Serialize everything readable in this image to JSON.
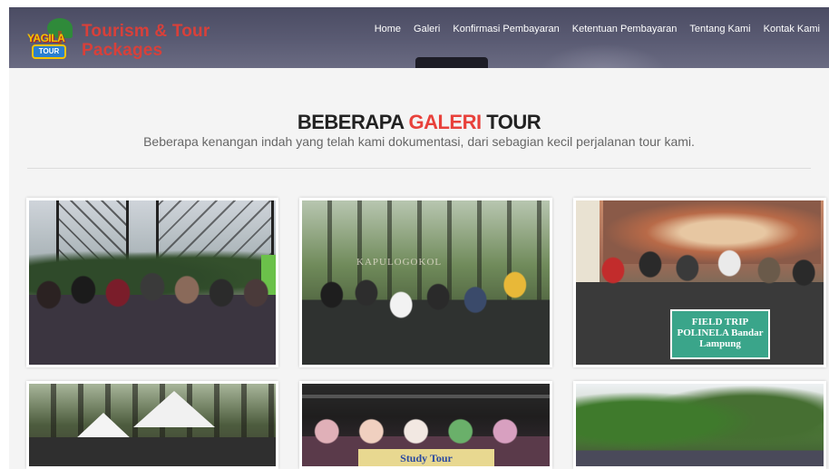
{
  "brand": {
    "logo_word": "YAGILA",
    "logo_bus": "TOUR",
    "name": "Tourism & Tour Packages"
  },
  "nav": [
    {
      "label": "Home"
    },
    {
      "label": "Galeri"
    },
    {
      "label": "Konfirmasi Pembayaran"
    },
    {
      "label": "Ketentuan Pembayaran"
    },
    {
      "label": "Tentang Kami"
    },
    {
      "label": "Kontak Kami"
    }
  ],
  "section": {
    "title_part1": "BEBERAPA ",
    "title_accent": "GALERI",
    "title_part2": " TOUR",
    "subtitle": "Beberapa kenangan indah yang telah kami dokumentasi, dari sebagian kecil perjalanan tour kami."
  },
  "gallery": [
    {
      "text": ""
    },
    {
      "text": "KAPULOGOKOL"
    },
    {
      "text": "FIELD TRIP POLINELA Bandar Lampung"
    },
    {
      "text": ""
    },
    {
      "text": "Study Tour"
    },
    {
      "text": ""
    }
  ],
  "colors": {
    "accent": "#e8413b",
    "header_bg": "#555670",
    "page_bg": "#f4f4f4"
  }
}
